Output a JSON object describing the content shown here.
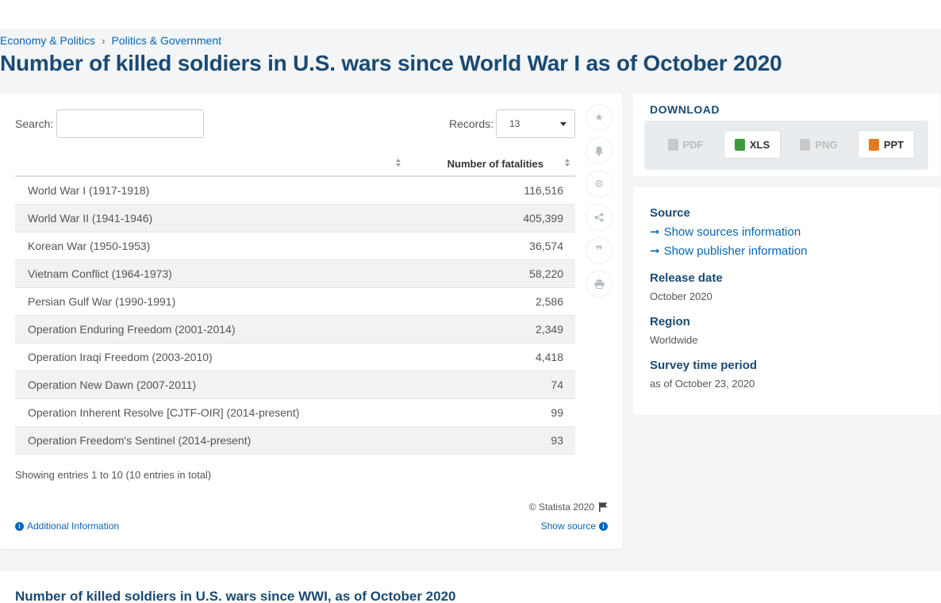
{
  "breadcrumb": {
    "item1": "Economy & Politics",
    "separator": "›",
    "item2": "Politics & Government"
  },
  "page_title": "Number of killed soldiers in U.S. wars since World War I as of October 2020",
  "table_controls": {
    "search_label": "Search:",
    "search_value": "",
    "records_label": "Records:",
    "records_value": "13"
  },
  "table": {
    "headers": [
      "",
      "Number of fatalities"
    ],
    "rows": [
      {
        "label": "World War I (1917-1918)",
        "value": "116,516"
      },
      {
        "label": "World War II (1941-1946)",
        "value": "405,399"
      },
      {
        "label": "Korean War (1950-1953)",
        "value": "36,574"
      },
      {
        "label": "Vietnam Conflict (1964-1973)",
        "value": "58,220"
      },
      {
        "label": "Persian Gulf War (1990-1991)",
        "value": "2,586"
      },
      {
        "label": "Operation Enduring Freedom (2001-2014)",
        "value": "2,349"
      },
      {
        "label": "Operation Iraqi Freedom (2003-2010)",
        "value": "4,418"
      },
      {
        "label": "Operation New Dawn (2007-2011)",
        "value": "74"
      },
      {
        "label": "Operation Inherent Resolve [CJTF-OIR] (2014-present)",
        "value": "99"
      },
      {
        "label": "Operation Freedom's Sentinel (2014-present)",
        "value": "93"
      }
    ],
    "showing": "Showing entries 1 to 10 (10 entries in total)"
  },
  "footer": {
    "copyright": "© Statista 2020",
    "additional_info": "Additional Information",
    "show_source": "Show source"
  },
  "tools": [
    "star-icon",
    "bell-icon",
    "gear-icon",
    "share-icon",
    "quote-icon",
    "print-icon"
  ],
  "download": {
    "title": "DOWNLOAD",
    "buttons": [
      {
        "label": "PDF",
        "enabled": false
      },
      {
        "label": "XLS",
        "enabled": true
      },
      {
        "label": "PNG",
        "enabled": false
      },
      {
        "label": "PPT",
        "enabled": true
      }
    ]
  },
  "meta": {
    "source_heading": "Source",
    "show_sources": "Show sources information",
    "show_publisher": "Show publisher information",
    "release_heading": "Release date",
    "release_value": "October 2020",
    "region_heading": "Region",
    "region_value": "Worldwide",
    "survey_heading": "Survey time period",
    "survey_value": "as of October 23, 2020"
  },
  "bottom_title": "Number of killed soldiers in U.S. wars since WWI, as of October 2020",
  "colors": {
    "link": "#0666b3",
    "heading": "#1a4a73",
    "xls": "#3a9b3a",
    "ppt": "#e07b25"
  }
}
